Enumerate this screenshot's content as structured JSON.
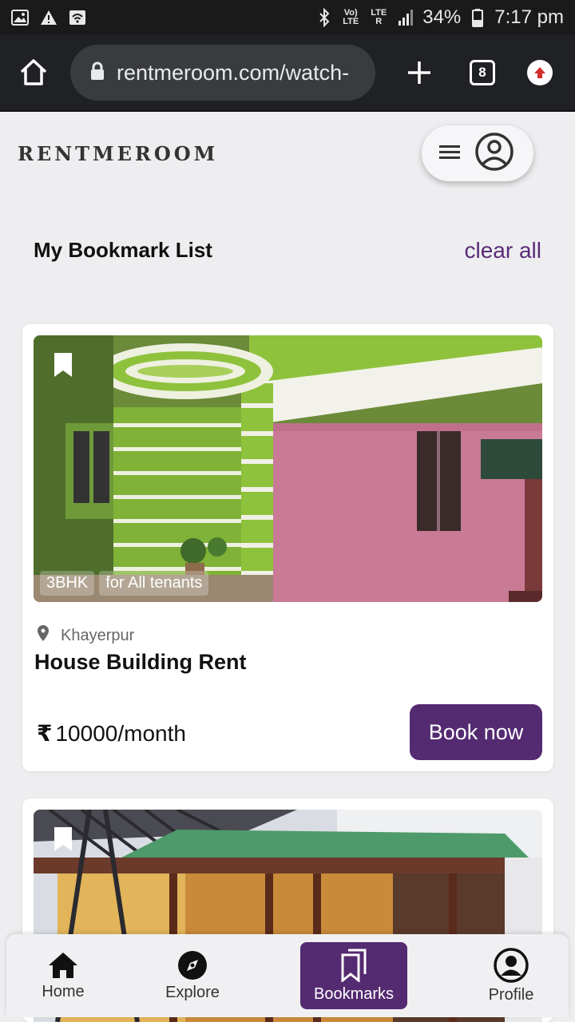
{
  "status_bar": {
    "network_small": "Vo) LTE",
    "lte_label": "LTE R",
    "battery": "34%",
    "time": "7:17 pm"
  },
  "browser": {
    "url": "rentmeroom.com/watch-",
    "tab_count": "8"
  },
  "header": {
    "brand": "RENTMEROOM"
  },
  "bookmarks": {
    "title": "My Bookmark List",
    "clear_label": "clear all"
  },
  "listings": [
    {
      "tags": [
        "3BHK",
        "for All tenants"
      ],
      "location": "Khayerpur",
      "title": "House Building Rent",
      "price": "10000/month",
      "currency": "₹",
      "cta": "Book now"
    }
  ],
  "nav": {
    "items": [
      {
        "label": "Home",
        "icon": "home-icon"
      },
      {
        "label": "Explore",
        "icon": "compass-icon"
      },
      {
        "label": "Bookmarks",
        "icon": "bookmarks-icon",
        "active": true
      },
      {
        "label": "Profile",
        "icon": "profile-icon"
      }
    ]
  },
  "colors": {
    "accent": "#542a71",
    "link": "#5b2a79",
    "page_bg": "#eeeef0"
  }
}
